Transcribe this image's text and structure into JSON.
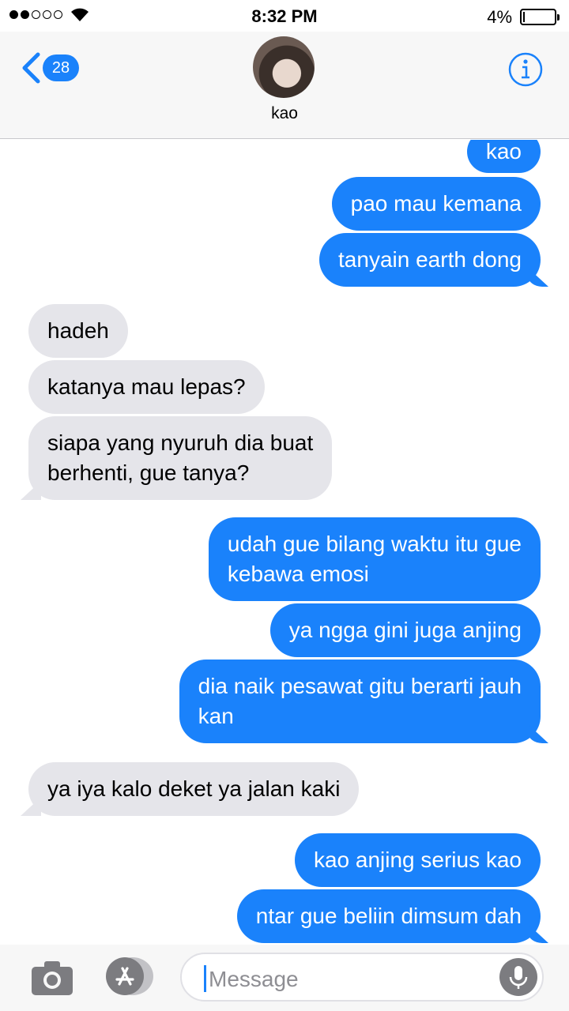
{
  "status_bar": {
    "time": "8:32 PM",
    "battery_percent_text": "4%",
    "battery_level": 0.04,
    "signal_bars_filled": 2,
    "signal_bars_total": 5
  },
  "header": {
    "back_badge_count": "28",
    "contact_name": "kao",
    "accent_color": "#1a82fb"
  },
  "messages": [
    {
      "direction": "out",
      "text": "kao"
    },
    {
      "direction": "out",
      "text": "pao mau kemana"
    },
    {
      "direction": "out",
      "text": "tanyain earth dong"
    },
    {
      "direction": "in",
      "text": "hadeh"
    },
    {
      "direction": "in",
      "text": "katanya mau lepas?"
    },
    {
      "direction": "in",
      "line1": "siapa yang nyuruh dia buat",
      "line2": "berhenti, gue tanya?"
    },
    {
      "direction": "out",
      "line1": "udah gue bilang waktu itu gue",
      "line2": "kebawa emosi"
    },
    {
      "direction": "out",
      "text": "ya ngga gini juga anjing"
    },
    {
      "direction": "out",
      "line1": "dia naik pesawat gitu berarti jauh",
      "line2": "kan"
    },
    {
      "direction": "in",
      "text": "ya iya kalo deket ya jalan kaki"
    },
    {
      "direction": "out",
      "text": "kao anjing serius kao"
    },
    {
      "direction": "out",
      "text": "ntar gue beliin dimsum dah"
    }
  ],
  "composer": {
    "placeholder": "Message"
  },
  "icons": {
    "back": "chevron-left-icon",
    "info": "info-icon",
    "camera": "camera-icon",
    "apps": "app-store-icon",
    "mic": "microphone-icon"
  }
}
